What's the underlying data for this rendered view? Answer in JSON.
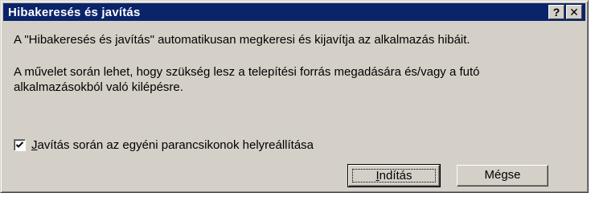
{
  "window": {
    "title": "Hibakeresés és javítás",
    "help_glyph": "?",
    "close_glyph": "✕"
  },
  "body": {
    "line1": "A \"Hibakeresés és javítás\" automatikusan megkeresi és kijavítja az alkalmazás hibáit.",
    "line2": "A művelet során lehet, hogy szükség lesz a telepítési forrás megadására és/vagy a futó",
    "line3": "alkalmazásokból való kilépésre."
  },
  "checkbox": {
    "checked": true,
    "label_mnemonic": "J",
    "label_rest": "avítás során az egyéni parancsikonok helyreállítása"
  },
  "buttons": {
    "start_mnemonic": "I",
    "start_rest": "ndítás",
    "cancel_label": "Mégse"
  },
  "colors": {
    "titlebar": "#0a246a",
    "face": "#d4d0c8"
  }
}
